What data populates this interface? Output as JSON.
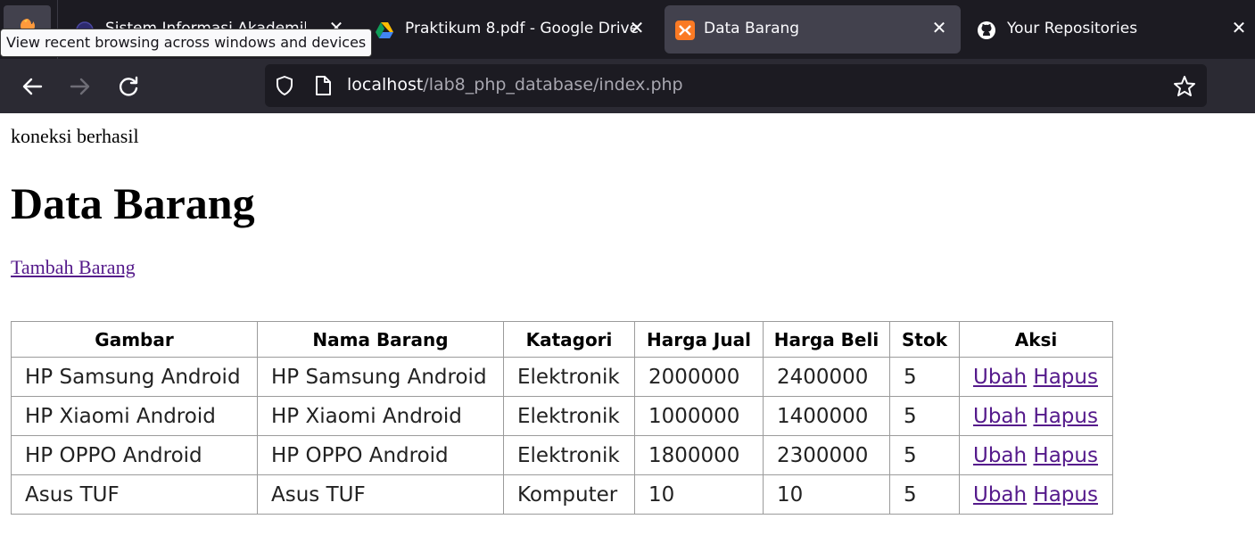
{
  "browser": {
    "tooltip": "View recent browsing across windows and devices",
    "tabs": [
      {
        "title": "Sistem Informasi Akademik",
        "icon": "academic-site-icon"
      },
      {
        "title": "Praktikum 8.pdf - Google Drive",
        "icon": "google-drive-icon"
      },
      {
        "title": "Data Barang",
        "icon": "xampp-icon",
        "active": true
      },
      {
        "title": "Your Repositories",
        "icon": "github-icon"
      }
    ],
    "url": {
      "host": "localhost",
      "path": "/lab8_php_database/index.php"
    },
    "colors": {
      "tabbar": "#1c1b22",
      "navbar": "#2b2a33",
      "active_tab": "#42414d",
      "link": "#551a8b"
    }
  },
  "page": {
    "connection_status": "koneksi berhasil",
    "title": "Data Barang",
    "add_link": "Tambah Barang",
    "table": {
      "headers": [
        "Gambar",
        "Nama Barang",
        "Katagori",
        "Harga Jual",
        "Harga Beli",
        "Stok",
        "Aksi"
      ],
      "rows": [
        [
          "HP Samsung Android",
          "HP Samsung Android",
          "Elektronik",
          "2000000",
          "2400000",
          "5"
        ],
        [
          "HP Xiaomi Android",
          "HP Xiaomi Android",
          "Elektronik",
          "1000000",
          "1400000",
          "5"
        ],
        [
          "HP OPPO Android",
          "HP OPPO Android",
          "Elektronik",
          "1800000",
          "2300000",
          "5"
        ],
        [
          "Asus TUF",
          "Asus TUF",
          "Komputer",
          "10",
          "10",
          "5"
        ]
      ],
      "action_edit": "Ubah",
      "action_delete": "Hapus"
    }
  }
}
